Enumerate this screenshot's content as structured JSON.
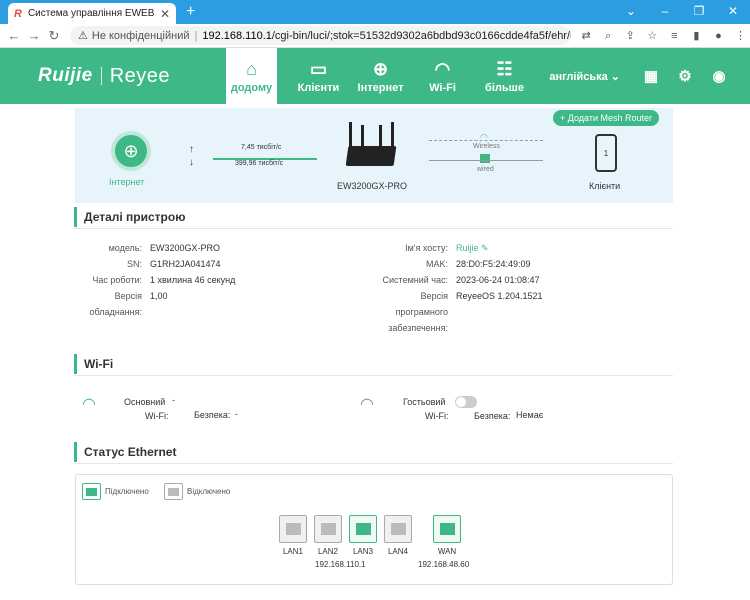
{
  "browser": {
    "tab_title": "Система управління EWEB",
    "tab_favicon": "R",
    "new_tab": "+",
    "security": "Не конфіденційний",
    "url_host": "192.168.110.1",
    "url_path": "/cgi-bin/luci/;stok=51532d9302a6bdbd93c0166cdde4fa5f/ehr/hom..."
  },
  "header": {
    "logo_ruijie": "Ruijie",
    "logo_reyee": "Reyee",
    "nav": [
      {
        "label": "додому",
        "icon": "home-icon",
        "active": true
      },
      {
        "label": "Клієнти",
        "icon": "devices-icon"
      },
      {
        "label": "Інтернет",
        "icon": "globe-icon"
      },
      {
        "label": "Wi-Fi",
        "icon": "wifi-icon"
      },
      {
        "label": "більше",
        "icon": "sliders-icon"
      }
    ],
    "language": "англійська",
    "accent": "#3fb887"
  },
  "topology": {
    "internet_label": "Інтернет",
    "upload": "7,45 тисбіт/с",
    "download": "399,96 тисбіт/с",
    "router_name": "EW3200GX-PRO",
    "add_mesh": "Додати Mesh Router",
    "wireless": "Wireless",
    "wired": "wired",
    "clients_label": "Клієнти",
    "clients_count": "1"
  },
  "device": {
    "title": "Деталі пристрою",
    "model_k": "модель:",
    "model_v": "EW3200GX-PRO",
    "sn_k": "SN:",
    "sn_v": "G1RH2JA041474",
    "uptime_k": "Час роботи:",
    "uptime_v": "1 хвилина 46 секунд",
    "hw_k1": "Версія",
    "hw_k2": "обладнання:",
    "hw_v": "1,00",
    "host_k": "Ім'я хосту:",
    "host_v": "Ruijie",
    "mac_k": "MAK:",
    "mac_v": "28:D0:F5:24:49:09",
    "time_k": "Системний час:",
    "time_v": "2023-06-24 01:08:47",
    "sw_k1": "Версія",
    "sw_k2": "програмного",
    "sw_k3": "забезпечення:",
    "sw_v": "ReyeeOS 1.204.1521"
  },
  "wifi": {
    "title": "Wi-Fi",
    "main_k1": "Основний",
    "main_k2": "Wi-Fi:",
    "main_v": "-",
    "sec_k": "Безпека:",
    "sec_v": "-",
    "guest_k1": "Гостьовий",
    "guest_k2": "Wi-Fi:",
    "guest_sec_k": "Безпека:",
    "guest_sec_v": "Немає"
  },
  "ethernet": {
    "title": "Статус Ethernet",
    "connected": "Підключено",
    "disconnected": "Відключено",
    "ports": [
      {
        "label": "LAN1",
        "connected": false
      },
      {
        "label": "LAN2",
        "connected": false
      },
      {
        "label": "LAN3",
        "connected": true
      },
      {
        "label": "LAN4",
        "connected": false
      },
      {
        "label": "WAN",
        "connected": true
      }
    ],
    "lan_ip": "192.168.110.1",
    "wan_ip": "192.168.48.60"
  }
}
